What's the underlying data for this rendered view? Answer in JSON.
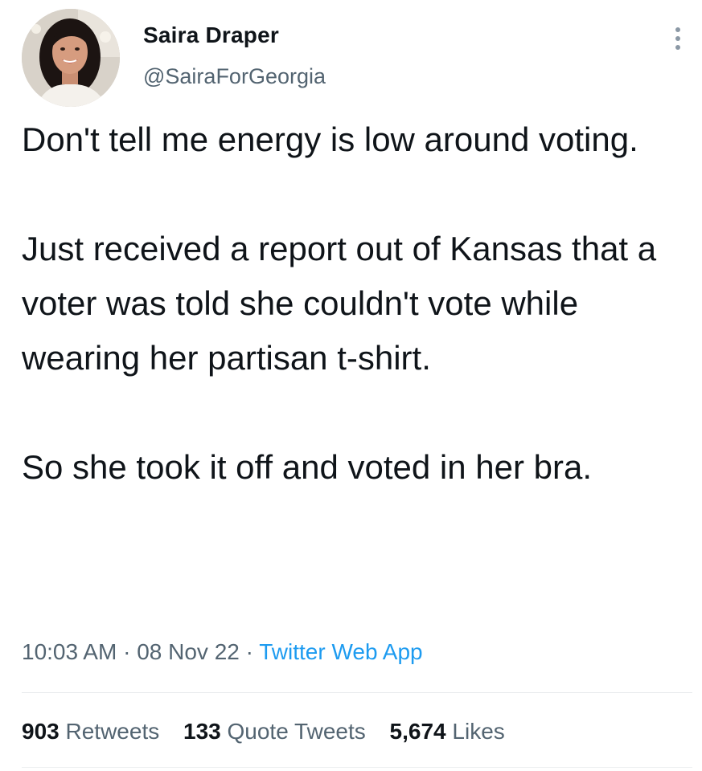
{
  "author": {
    "display_name": "Saira Draper",
    "handle": "@SairaForGeorgia",
    "avatar_icon": "profile-photo"
  },
  "more_icon": "more-options-vertical-icon",
  "tweet": {
    "paragraphs": [
      "Don't tell me energy is low around voting.",
      "Just received a report out of Kansas that a voter was told she couldn't vote while wearing her partisan t-shirt.",
      "So she took it off and voted in her bra."
    ]
  },
  "meta": {
    "time": "10:03 AM",
    "separator": "·",
    "date": "08 Nov 22",
    "source": "Twitter Web App"
  },
  "stats": {
    "retweets_count": "903",
    "retweets_label": "Retweets",
    "quotes_count": "133",
    "quotes_label": "Quote Tweets",
    "likes_count": "5,674",
    "likes_label": "Likes"
  },
  "colors": {
    "text": "#0f1419",
    "secondary": "#536471",
    "link": "#1d9bf0",
    "divider": "#e6e9eb"
  }
}
